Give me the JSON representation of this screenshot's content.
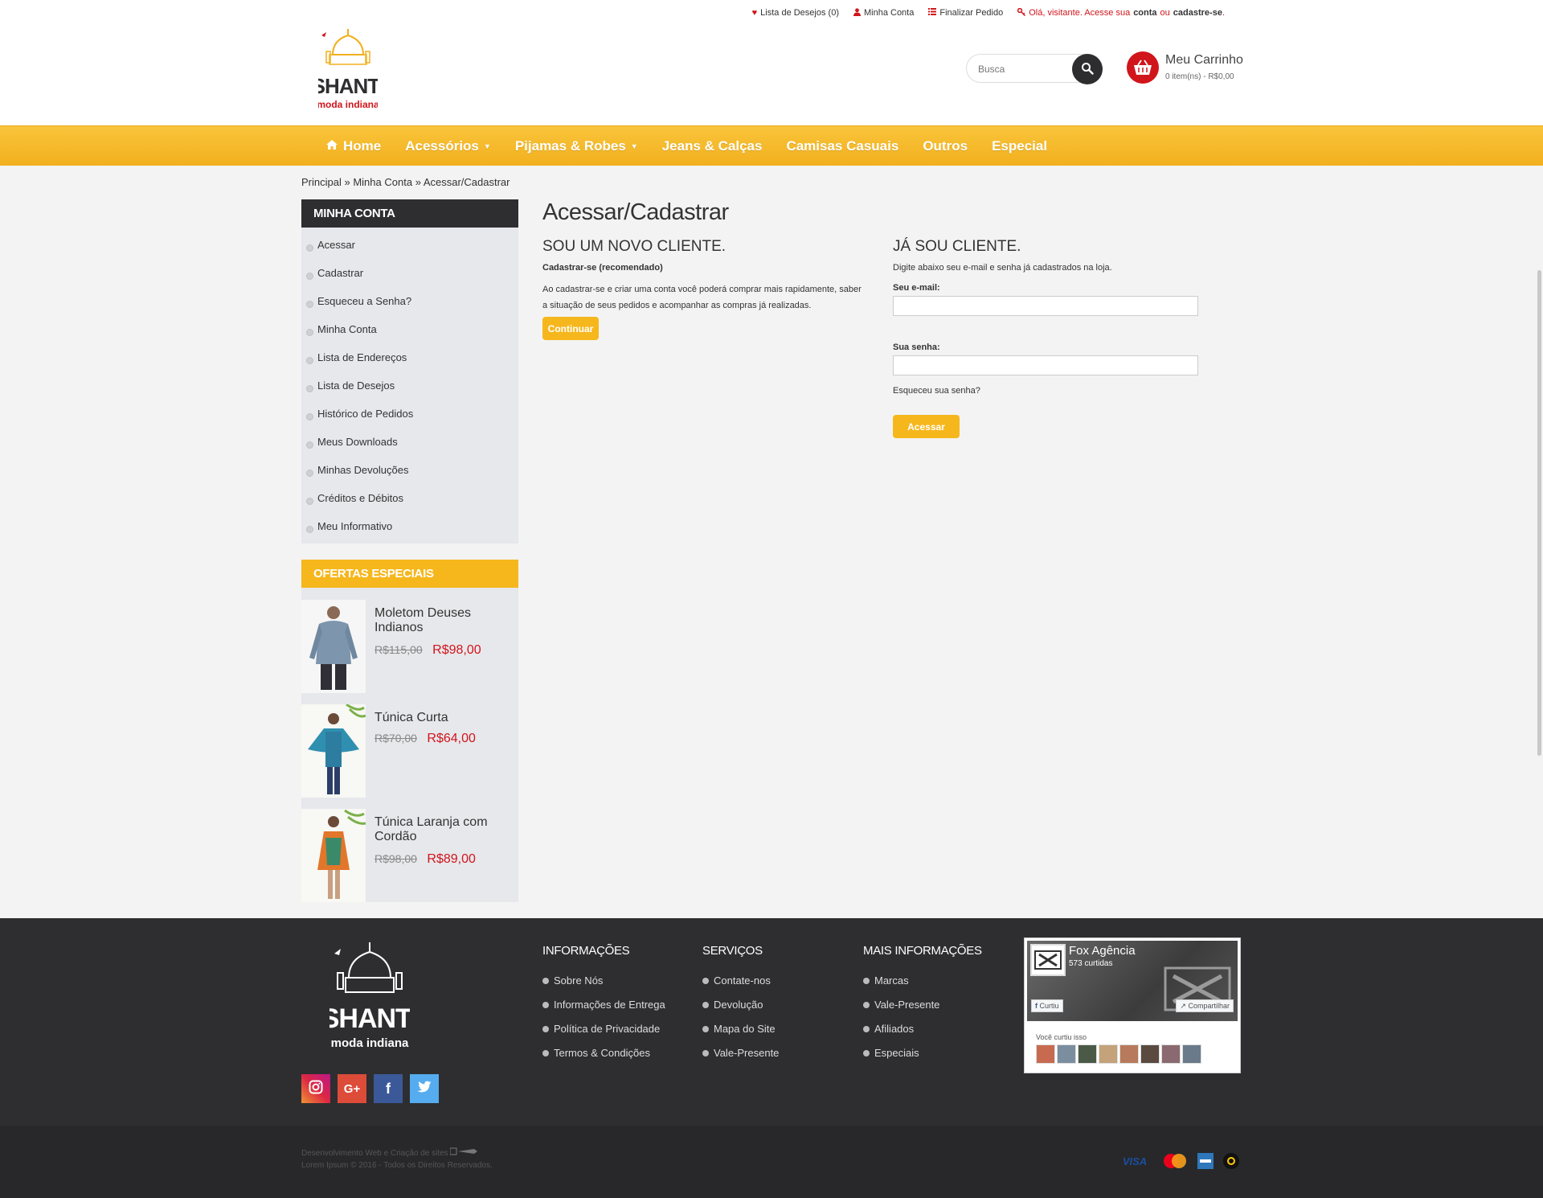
{
  "toplinks": {
    "wishlist": "Lista de Desejos (0)",
    "account": "Minha Conta",
    "checkout": "Finalizar Pedido",
    "greeting_prefix": "Olá, visitante. Acesse sua",
    "greeting_conta": "conta",
    "greeting_or": "ou",
    "greeting_register": "cadastre-se",
    "greeting_end": "."
  },
  "logo": {
    "brand": "SHANTI",
    "tagline": "moda indiana"
  },
  "search": {
    "placeholder": "Busca"
  },
  "cart": {
    "title": "Meu Carrinho",
    "summary": "0 item(ns) - R$0,00"
  },
  "nav": {
    "items": [
      {
        "label": "Home"
      },
      {
        "label": "Acessórios"
      },
      {
        "label": "Pijamas & Robes"
      },
      {
        "label": "Jeans & Calças"
      },
      {
        "label": "Camisas Casuais"
      },
      {
        "label": "Outros"
      },
      {
        "label": "Especial"
      }
    ]
  },
  "breadcrumb": {
    "items": [
      "Principal",
      "Minha Conta",
      "Acessar/Cadastrar"
    ],
    "separator": "»"
  },
  "sidebar": {
    "account_title": "MINHA CONTA",
    "account_items": [
      "Acessar",
      "Cadastrar",
      "Esqueceu a Senha?",
      "Minha Conta",
      "Lista de Endereços",
      "Lista de Desejos",
      "Histórico de Pedidos",
      "Meus Downloads",
      "Minhas Devoluções",
      "Créditos e Débitos",
      "Meu Informativo"
    ],
    "offers_title": "OFERTAS ESPECIAIS",
    "offers": [
      {
        "name": "Moletom Deuses Indianos",
        "old_price": "R$115,00",
        "price": "R$98,00"
      },
      {
        "name": "Túnica Curta",
        "old_price": "R$70,00",
        "price": "R$64,00"
      },
      {
        "name": "Túnica Laranja com Cordão",
        "old_price": "R$98,00",
        "price": "R$89,00"
      }
    ]
  },
  "main": {
    "title": "Acessar/Cadastrar",
    "new_customer": {
      "heading": "SOU UM NOVO CLIENTE.",
      "subheading": "Cadastrar-se (recomendado)",
      "text": "Ao cadastrar-se e criar uma conta você poderá comprar mais rapidamente, saber a situação de seus pedidos e acompanhar as compras já realizadas.",
      "button": "Continuar"
    },
    "returning_customer": {
      "heading": "JÁ SOU CLIENTE.",
      "intro": "Digite abaixo seu e-mail e senha já cadastrados na loja.",
      "email_label": "Seu e-mail:",
      "email_value": "",
      "password_label": "Sua senha:",
      "password_value": "",
      "forgot": "Esqueceu sua senha?",
      "button": "Acessar"
    }
  },
  "footer": {
    "columns": [
      {
        "title": "INFORMAÇÕES",
        "items": [
          "Sobre Nós",
          "Informações de Entrega",
          "Política de Privacidade",
          "Termos & Condições"
        ]
      },
      {
        "title": "SERVIÇOS",
        "items": [
          "Contate-nos",
          "Devolução",
          "Mapa do Site",
          "Vale-Presente"
        ]
      },
      {
        "title": "MAIS INFORMAÇÕES",
        "items": [
          "Marcas",
          "Vale-Presente",
          "Afiliados",
          "Especiais"
        ]
      }
    ],
    "facebook": {
      "page_name": "Fox Agência",
      "likes": "573 curtidas",
      "like_button": "Curtiu",
      "share_button": "Compartilhar",
      "faces_label": "Você curtiu isso"
    },
    "social_icons": [
      "instagram-icon",
      "google-plus-icon",
      "facebook-icon",
      "twitter-icon"
    ],
    "credits_line1": "Desenvolvimento Web e Criação de sites",
    "credits_line2": "Lorem Ipsum © 2016 - Todos os Direitos Reservados.",
    "payment_icons": [
      "visa-icon",
      "mastercard-icon",
      "amex-icon",
      "elo-icon"
    ]
  },
  "colors": {
    "accent_yellow": "#f6b71d",
    "accent_red": "#d0151b",
    "dark": "#2e2e30",
    "sidebar_bg": "#e7e8ec"
  }
}
